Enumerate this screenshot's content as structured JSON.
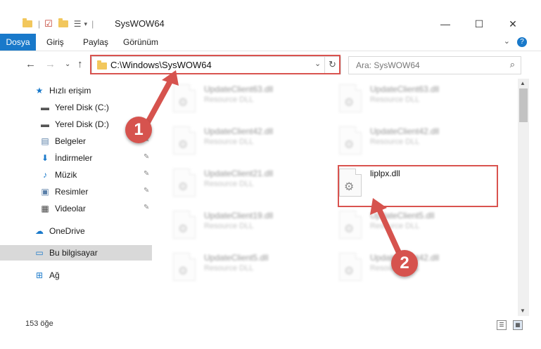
{
  "window": {
    "title": "SysWOW64"
  },
  "ribbon": {
    "tabs": [
      "Dosya",
      "Giriş",
      "Paylaş",
      "Görünüm"
    ],
    "help": "?"
  },
  "address": {
    "path": "C:\\Windows\\SysWOW64"
  },
  "search": {
    "placeholder": "Ara: SysWOW64"
  },
  "sidebar": {
    "items": [
      {
        "label": "Hızlı erişim"
      },
      {
        "label": "Yerel Disk (C:)"
      },
      {
        "label": "Yerel Disk (D:)"
      },
      {
        "label": "Belgeler"
      },
      {
        "label": "İndirmeler"
      },
      {
        "label": "Müzik"
      },
      {
        "label": "Resimler"
      },
      {
        "label": "Videolar"
      },
      {
        "label": "OneDrive"
      },
      {
        "label": "Bu bilgisayar"
      },
      {
        "label": "Ağ"
      }
    ]
  },
  "files": [
    {
      "name": "UpdateClient63.dll",
      "desc": "Resource DLL"
    },
    {
      "name": "UpdateClient63.dll",
      "desc": "Resource DLL"
    },
    {
      "name": "UpdateClient42.dll",
      "desc": "Resource DLL"
    },
    {
      "name": "UpdateClient42.dll",
      "desc": "Resource DLL"
    },
    {
      "name": "UpdateClient21.dll",
      "desc": "Resource DLL"
    },
    {
      "name": "liplpx.dll",
      "desc": ""
    },
    {
      "name": "UpdateClient19.dll",
      "desc": "Resource DLL"
    },
    {
      "name": "UpdateClient5.dll",
      "desc": "Resource DLL"
    },
    {
      "name": "UpdateClient5.dll",
      "desc": "Resource DLL"
    },
    {
      "name": "UpdateClient42.dll",
      "desc": "Resource DLL"
    }
  ],
  "status": {
    "count": "153 öğe"
  },
  "annotations": {
    "step1": "1",
    "step2": "2"
  },
  "colors": {
    "accent": "#1979ca",
    "highlight": "#d9534f",
    "folder": "#f2c75c"
  }
}
